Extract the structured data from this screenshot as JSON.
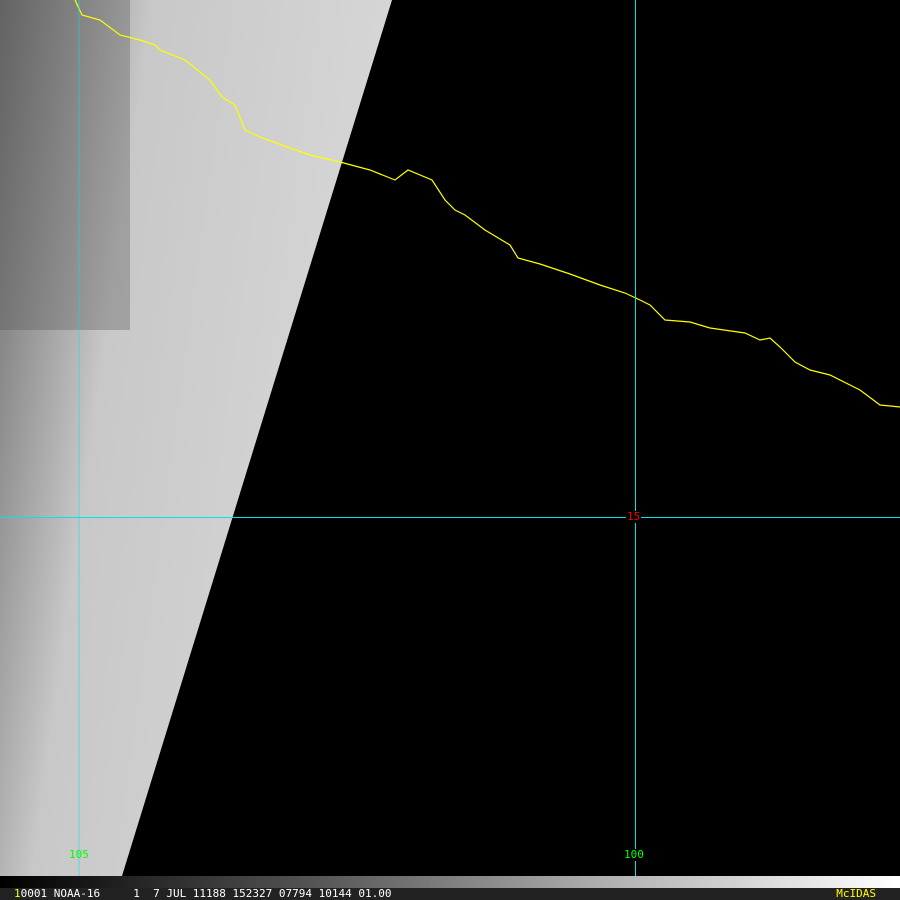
{
  "image": {
    "satellite": "NOAA-16",
    "frame_number": "1",
    "info_text": "0001 NOAA-16     1  7 JUL 11188 152327 07794 10144 01.00",
    "software_label": "McIDAS"
  },
  "grid_labels": {
    "lon_105": "105",
    "lon_100": "100",
    "lat_15": "15"
  },
  "colors": {
    "coastline": "#ffff00",
    "grid": "#00e5e5",
    "lon_label": "#00ff00",
    "lat_label": "#ff0000"
  }
}
